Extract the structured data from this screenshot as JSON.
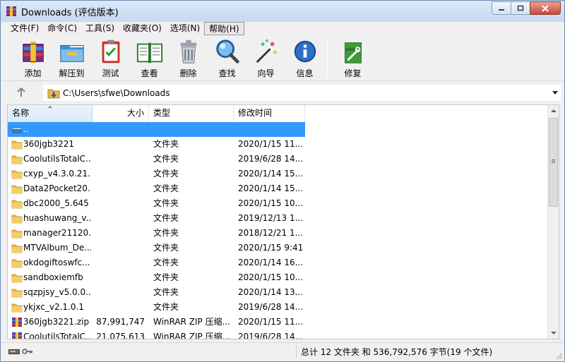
{
  "window": {
    "title": "Downloads (评估版本)"
  },
  "menu": [
    {
      "label": "文件(F)"
    },
    {
      "label": "命令(C)"
    },
    {
      "label": "工具(S)"
    },
    {
      "label": "收藏夹(O)"
    },
    {
      "label": "选项(N)"
    },
    {
      "label": "帮助(H)"
    }
  ],
  "toolbar": {
    "tools": [
      {
        "label": "添加",
        "icon": "add-icon"
      },
      {
        "label": "解压到",
        "icon": "extract-icon"
      },
      {
        "label": "测试",
        "icon": "test-icon"
      },
      {
        "label": "查看",
        "icon": "view-icon"
      },
      {
        "label": "删除",
        "icon": "delete-icon"
      },
      {
        "label": "查找",
        "icon": "find-icon"
      },
      {
        "label": "向导",
        "icon": "wizard-icon"
      },
      {
        "label": "信息",
        "icon": "info-icon"
      },
      {
        "label": "修复",
        "icon": "repair-icon"
      }
    ]
  },
  "address": {
    "path": "C:\\Users\\sfwe\\Downloads"
  },
  "columns": {
    "name": "名称",
    "size": "大小",
    "type": "类型",
    "modified": "修改时间"
  },
  "files": [
    {
      "name": "..",
      "size": "",
      "type": "",
      "modified": "",
      "kind": "parent"
    },
    {
      "name": "360jgb3221",
      "size": "",
      "type": "文件夹",
      "modified": "2020/1/15 11...",
      "kind": "folder"
    },
    {
      "name": "CoolutilsTotalC...",
      "size": "",
      "type": "文件夹",
      "modified": "2019/6/28 14...",
      "kind": "folder"
    },
    {
      "name": "cxyp_v4.3.0.21...",
      "size": "",
      "type": "文件夹",
      "modified": "2020/1/14 15...",
      "kind": "folder"
    },
    {
      "name": "Data2Pocket20...",
      "size": "",
      "type": "文件夹",
      "modified": "2020/1/14 15...",
      "kind": "folder"
    },
    {
      "name": "dbc2000_5.645",
      "size": "",
      "type": "文件夹",
      "modified": "2020/1/15 10...",
      "kind": "folder"
    },
    {
      "name": "huashuwang_v...",
      "size": "",
      "type": "文件夹",
      "modified": "2019/12/13 1...",
      "kind": "folder"
    },
    {
      "name": "manager21120...",
      "size": "",
      "type": "文件夹",
      "modified": "2018/12/21 1...",
      "kind": "folder"
    },
    {
      "name": "MTVAlbum_De...",
      "size": "",
      "type": "文件夹",
      "modified": "2020/1/15 9:41",
      "kind": "folder"
    },
    {
      "name": "okdogiftoswfc...",
      "size": "",
      "type": "文件夹",
      "modified": "2020/1/14 16...",
      "kind": "folder"
    },
    {
      "name": "sandboxiemfb",
      "size": "",
      "type": "文件夹",
      "modified": "2020/1/15 10...",
      "kind": "folder"
    },
    {
      "name": "sqzpjsy_v5.0.0....",
      "size": "",
      "type": "文件夹",
      "modified": "2020/1/14 13...",
      "kind": "folder"
    },
    {
      "name": "ykjxc_v2.1.0.1",
      "size": "",
      "type": "文件夹",
      "modified": "2019/6/28 14...",
      "kind": "folder"
    },
    {
      "name": "360jgb3221.zip",
      "size": "87,991,747",
      "type": "WinRAR ZIP 压缩...",
      "modified": "2020/1/15 11...",
      "kind": "zip"
    },
    {
      "name": "CoolutilsTotalC...",
      "size": "21,075,613",
      "type": "WinRAR ZIP 压缩...",
      "modified": "2019/6/28 14...",
      "kind": "zip"
    }
  ],
  "status": {
    "summary": "总计 12 文件夹 和 536,792,576 字节(19 个文件)"
  },
  "colors": {
    "selection": "#3399ff",
    "folder": "#e8b64a",
    "title_bar": "#c7d9f0"
  }
}
